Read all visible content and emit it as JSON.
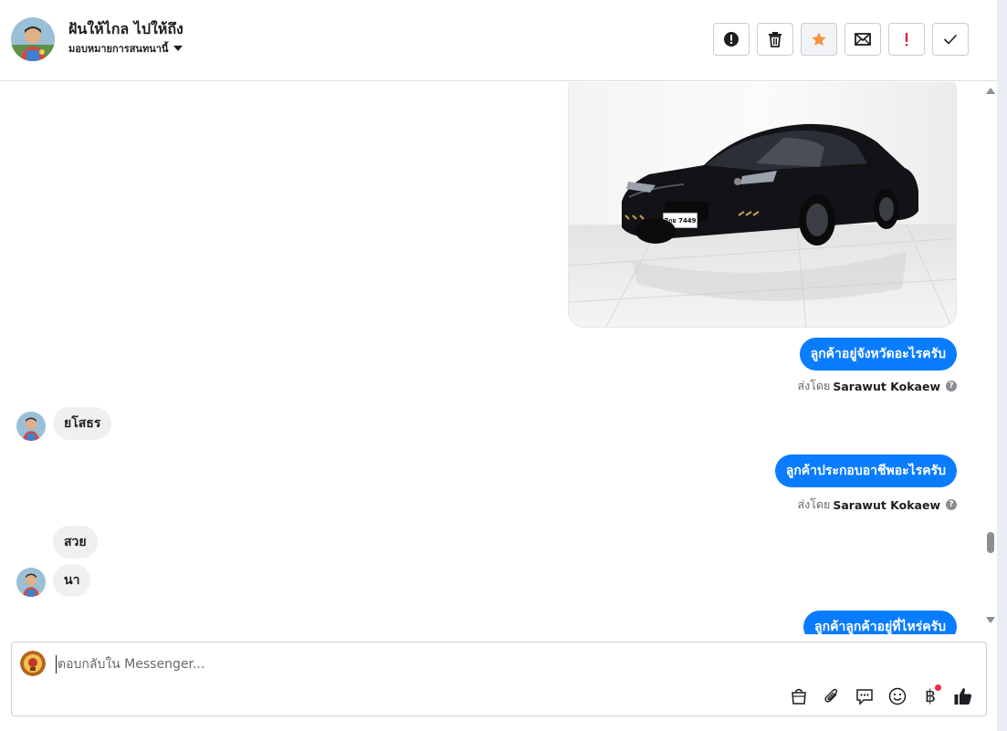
{
  "header": {
    "name": "ฝันให้ไกล ไปให้ถึง",
    "assign_label": "มอบหมายการสนทนานี้"
  },
  "actions": [
    {
      "name": "spam-button",
      "icon": "alert-circle-icon"
    },
    {
      "name": "delete-button",
      "icon": "trash-icon"
    },
    {
      "name": "star-button",
      "icon": "star-icon"
    },
    {
      "name": "mark-unread-button",
      "icon": "envelope-icon"
    },
    {
      "name": "follow-up-button",
      "icon": "exclamation-icon"
    },
    {
      "name": "done-button",
      "icon": "checkmark-icon"
    }
  ],
  "messages": {
    "m1": "ลูกค้าอยู่จังหวัดอะไรครับ",
    "m2": "ยโสธร",
    "m3": "ลูกค้าประกอบอาชีพอะไรครับ",
    "m4": "สวย",
    "m5": "นา",
    "m6": "ลูกค้าลูกค้าอยู่ที่ไหร่ครับ"
  },
  "car_image": {
    "plate_line1": "7กย 7449"
  },
  "sent_by": {
    "prefix": "ส่งโดย",
    "agent": "Sarawut Kokaew"
  },
  "composer": {
    "placeholder": "ตอบกลับใน Messenger..."
  },
  "colors": {
    "accent": "#0a7cff",
    "star": "#f7923a",
    "incoming": "#f0f0f0",
    "badge": "#f02849"
  }
}
